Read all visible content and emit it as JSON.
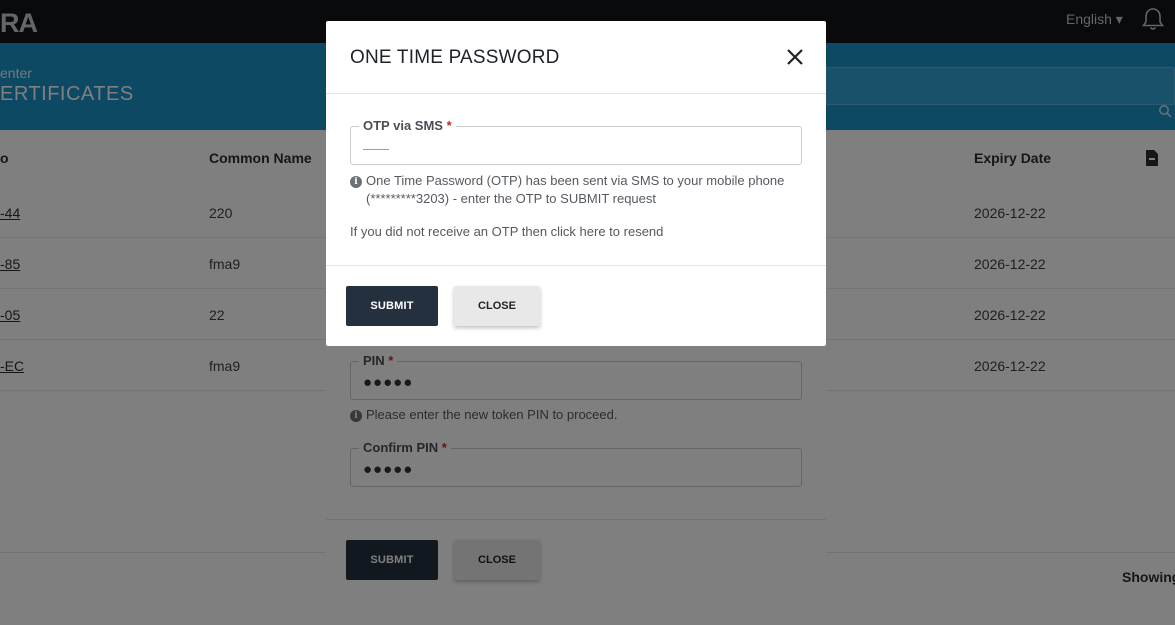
{
  "topbar": {
    "logo": "RA",
    "language": "English ▾"
  },
  "subheader": {
    "breadcrumb": "enter",
    "title": "ERTIFICATES"
  },
  "table": {
    "headers": [
      "o",
      "Common Name",
      "Expiry Date"
    ],
    "rows": [
      {
        "id": "-44",
        "common_name": "220",
        "expiry": "2026-12-22"
      },
      {
        "id": "-85",
        "common_name": "fma9",
        "expiry": "2026-12-22"
      },
      {
        "id": "-05",
        "common_name": "22",
        "expiry": "2026-12-22"
      },
      {
        "id": "-EC",
        "common_name": "fma9",
        "expiry": "2026-12-22"
      }
    ],
    "showing": "Showing"
  },
  "pin_dialog": {
    "pin_label": "PIN",
    "pin_value": "●●●●●",
    "pin_hint": "Please enter the new token PIN to proceed.",
    "confirm_label": "Confirm PIN",
    "confirm_value": "●●●●●",
    "submit": "SUBMIT",
    "close": "CLOSE"
  },
  "otp_modal": {
    "title": "ONE TIME PASSWORD",
    "field_label": "OTP via SMS",
    "required_mark": "*",
    "info_line1": "One Time Password (OTP) has been sent via SMS to your mobile phone",
    "info_line2": "(*********3203) - enter the OTP to SUBMIT request",
    "resend": "If you did not receive an OTP then click here to resend",
    "submit": "SUBMIT",
    "close": "CLOSE"
  },
  "colors": {
    "topbar": "#111418",
    "subheader": "#1b93c7",
    "submit_button": "#25303f",
    "required": "#c62828"
  }
}
